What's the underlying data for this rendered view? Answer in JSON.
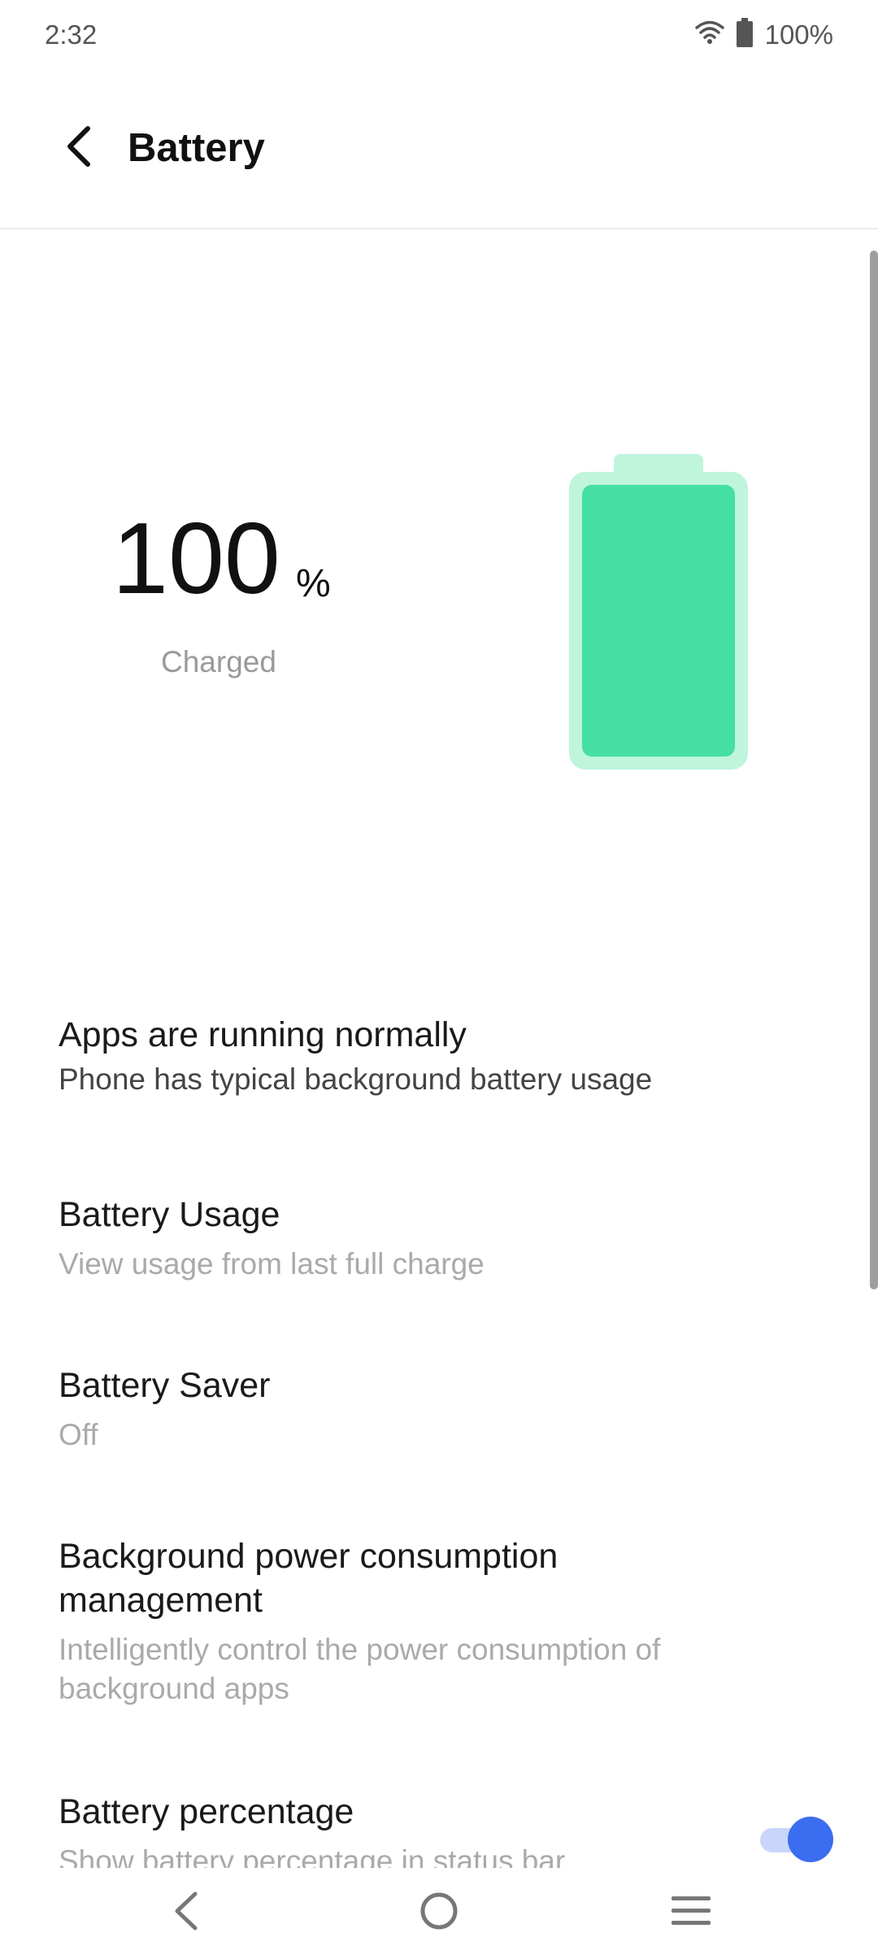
{
  "status_bar": {
    "time": "2:32",
    "battery_percent": "100%",
    "icons": [
      "wifi-icon",
      "battery-full-icon"
    ]
  },
  "app_bar": {
    "title": "Battery",
    "back_icon": "chevron-left-icon"
  },
  "battery": {
    "level_value": "100",
    "level_unit": "%",
    "status_label": "Charged",
    "fill_fraction": 1.0,
    "colors": {
      "fill": "#45dfa5",
      "shell": "#bff5dc"
    }
  },
  "items": [
    {
      "title": "Apps are running normally",
      "subtitle": "Phone has typical background battery usage"
    },
    {
      "title": "Battery Usage",
      "subtitle": "View usage from last full charge"
    },
    {
      "title": "Battery Saver",
      "subtitle": "Off"
    },
    {
      "title": "Background power consumption management",
      "subtitle": "Intelligently control the power consumption of background apps"
    },
    {
      "title": "Battery percentage",
      "subtitle": "Show battery percentage in status bar",
      "toggle_on": true
    }
  ],
  "colors": {
    "accent": "#3b6df1"
  },
  "nav": {
    "icons": [
      "back-triangle-icon",
      "home-circle-icon",
      "menu-icon"
    ]
  }
}
